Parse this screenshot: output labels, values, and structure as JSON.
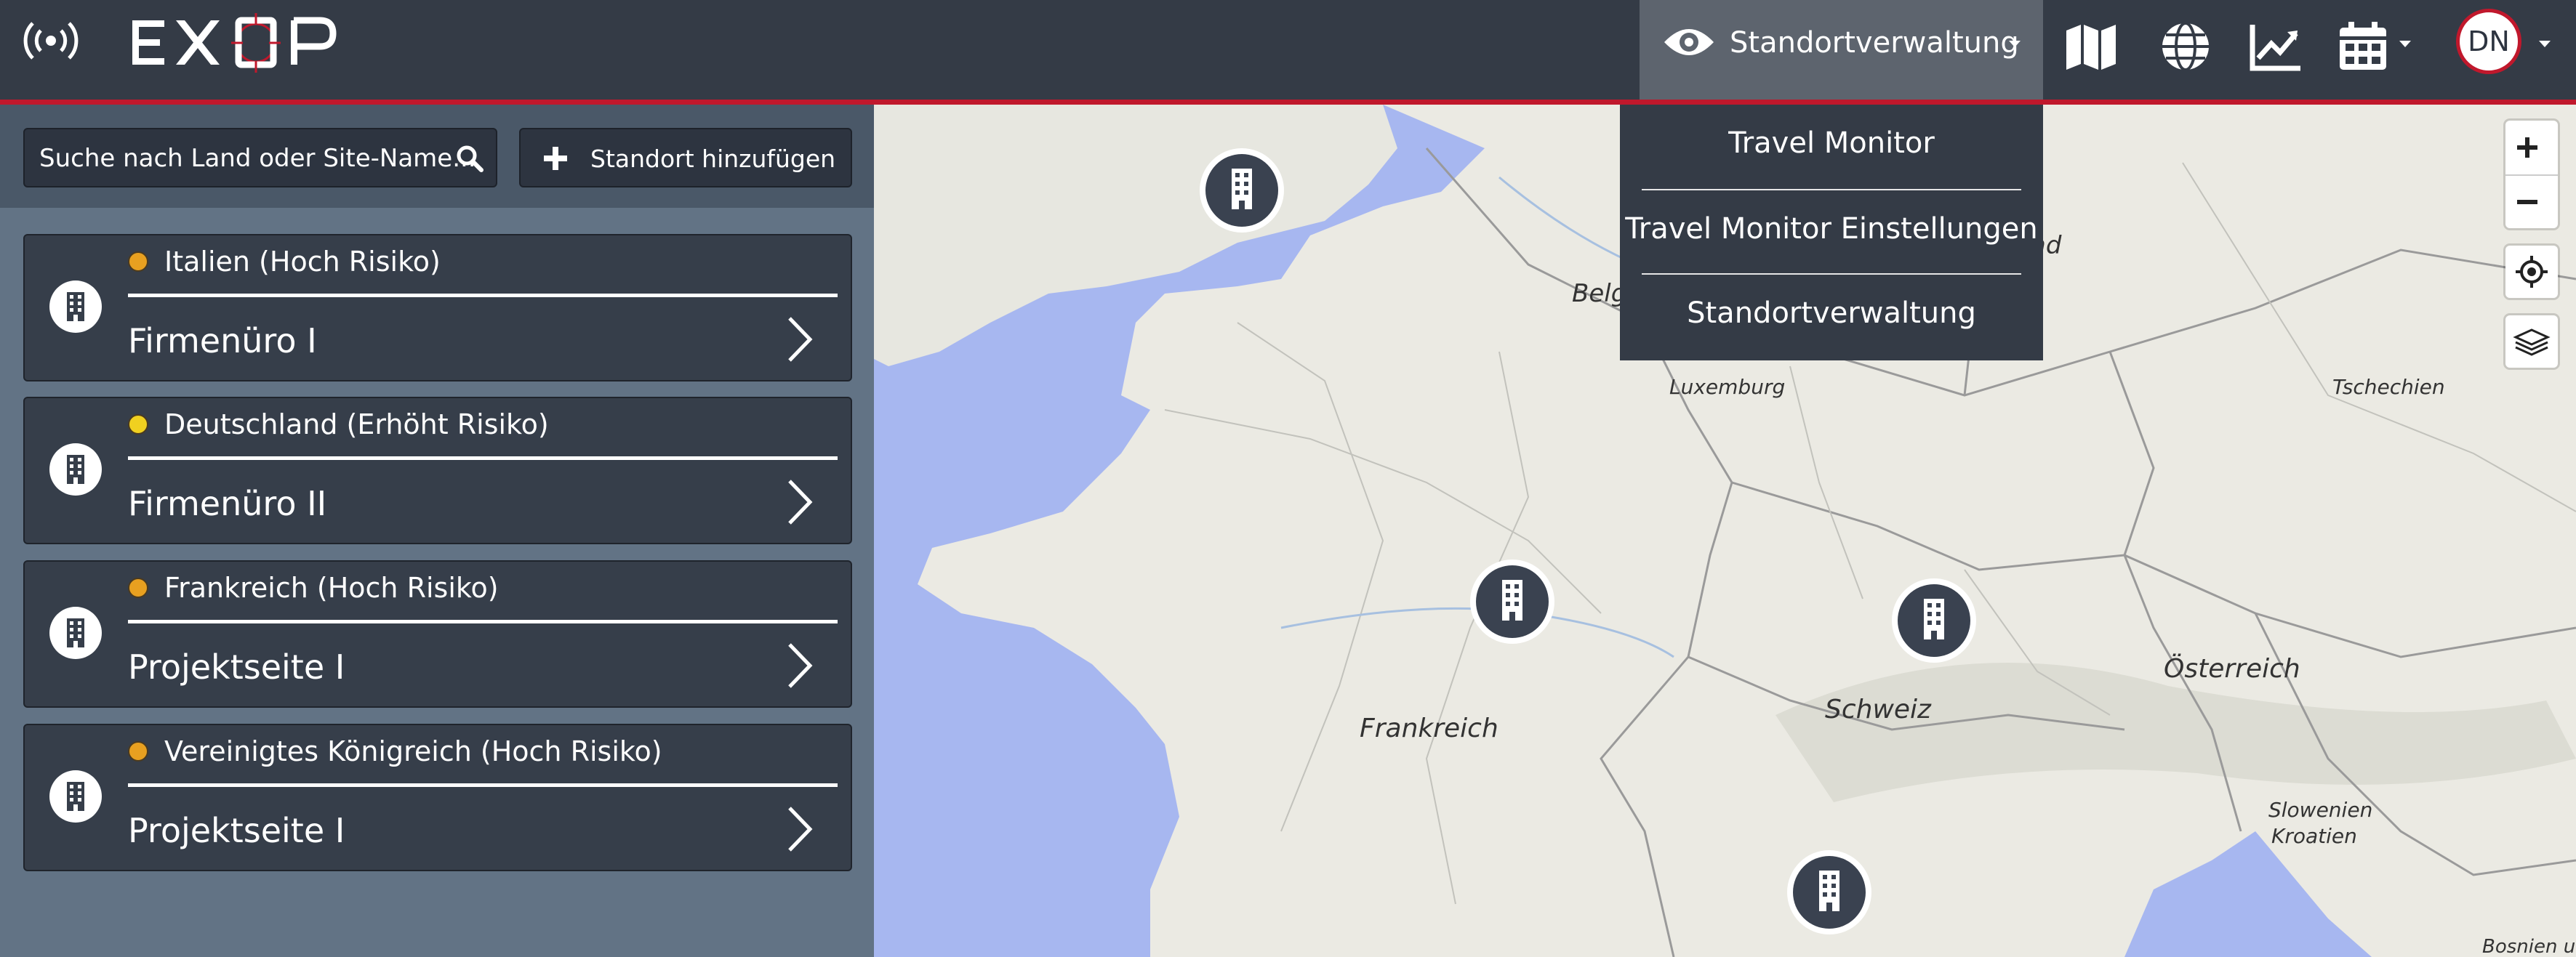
{
  "header": {
    "logo_text": "EXOP",
    "active_nav_label": "Standortverwaltung",
    "icons": [
      "signal-icon",
      "eye-icon",
      "map-icon",
      "globe-icon",
      "chart-line-icon",
      "calendar-icon"
    ],
    "avatar_initials": "DN",
    "accent_color": "#c0182c"
  },
  "nav_dropdown": {
    "items": [
      "Travel Monitor",
      "Travel Monitor Einstellungen",
      "Standortverwaltung"
    ]
  },
  "sidebar": {
    "search_placeholder": "Suche nach Land oder Site-Name...",
    "add_button_label": "Standort hinzufügen",
    "sites": [
      {
        "country": "Italien (Hoch Risiko)",
        "name": "Firmenüro I",
        "risk_color": "#e8a020"
      },
      {
        "country": "Deutschland (Erhöht Risiko)",
        "name": "Firmenüro II",
        "risk_color": "#f0d020"
      },
      {
        "country": "Frankreich (Hoch Risiko)",
        "name": "Projektseite I",
        "risk_color": "#e8a020"
      },
      {
        "country": "Vereinigtes Königreich (Hoch Risiko)",
        "name": "Projektseite I",
        "risk_color": "#e8a020"
      }
    ]
  },
  "map": {
    "labels": {
      "belgium": "Belg",
      "netherlands": "land",
      "luxembourg": "Luxemburg",
      "czechia": "Tschechien",
      "france": "Frankreich",
      "switzerland": "Schweiz",
      "austria": "Österreich",
      "slovenia": "Slowenien",
      "croatia": "Kroatien",
      "bosnia": "Bosnien u"
    },
    "controls": [
      "zoom-in",
      "zoom-out",
      "locate",
      "layers"
    ]
  }
}
